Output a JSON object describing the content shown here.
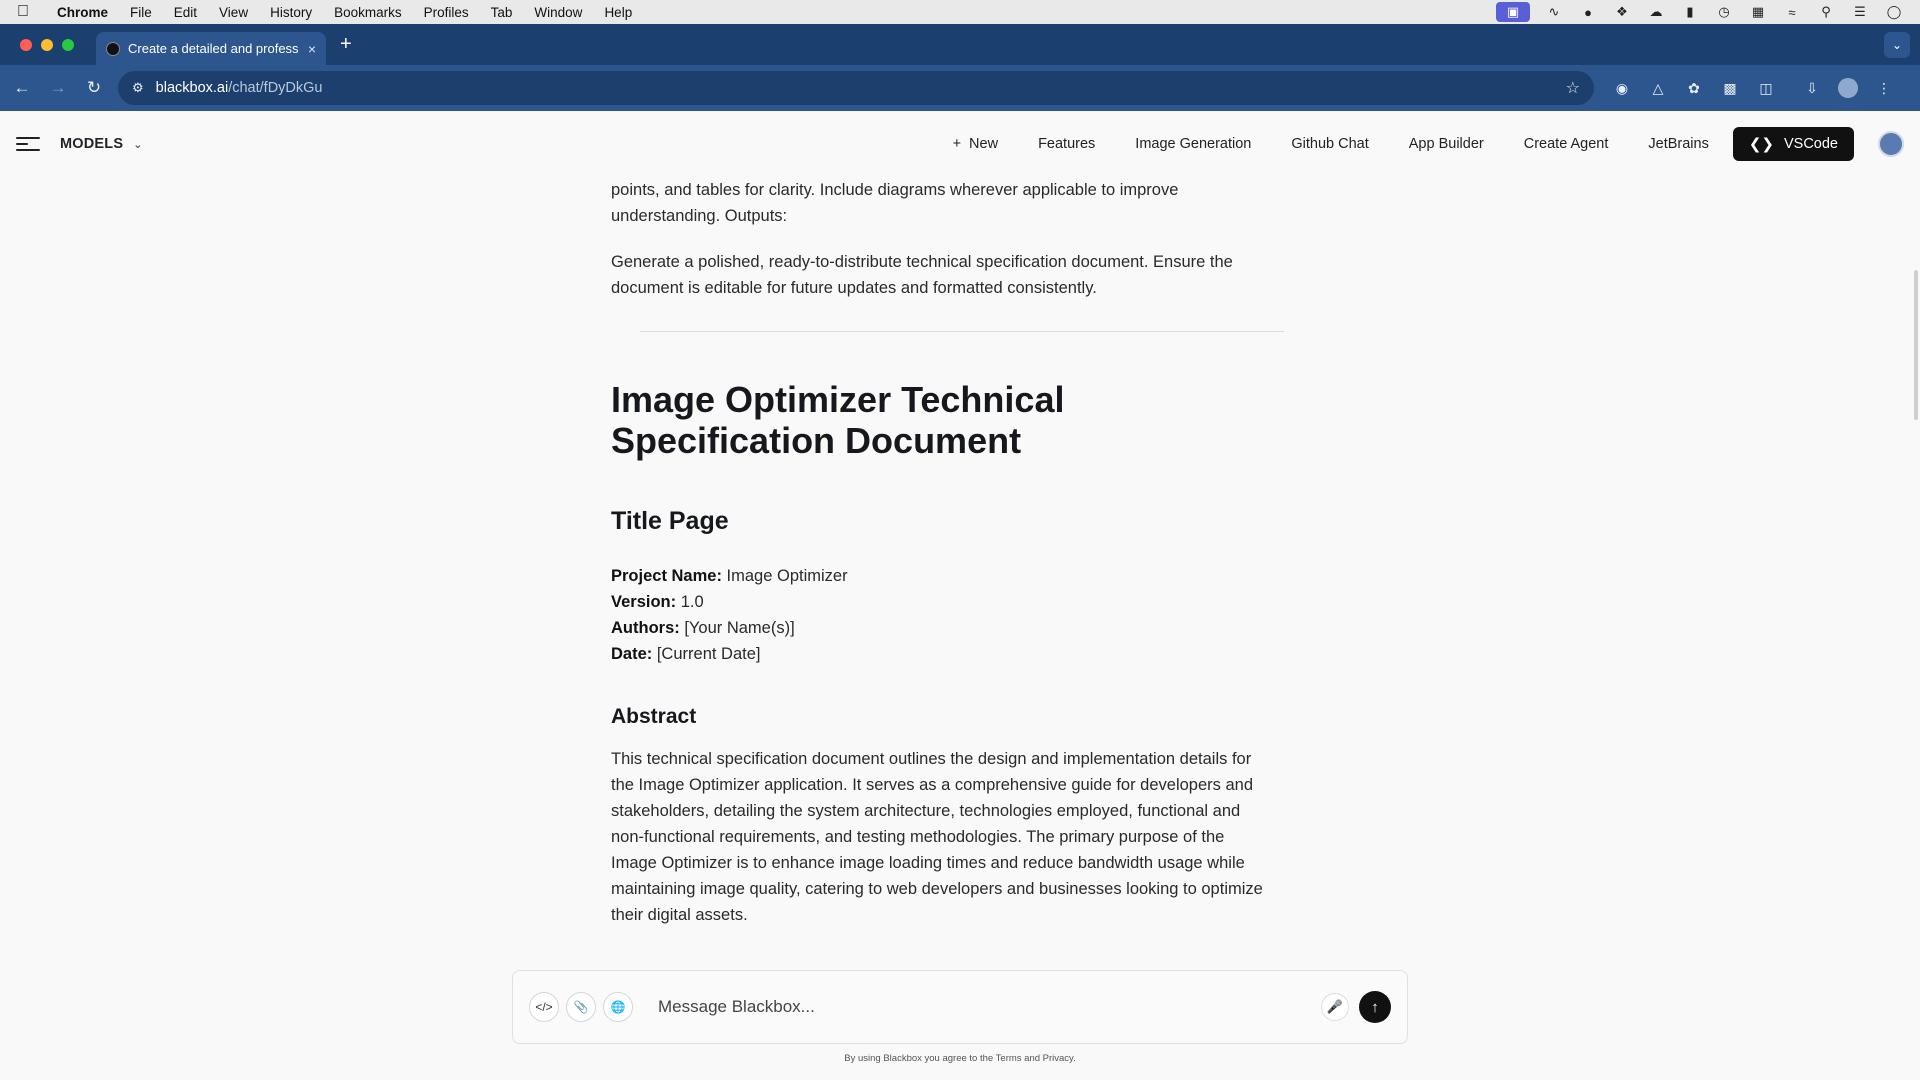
{
  "menubar": {
    "apple": "",
    "items": [
      "Chrome",
      "File",
      "Edit",
      "View",
      "History",
      "Bookmarks",
      "Profiles",
      "Tab",
      "Window",
      "Help"
    ]
  },
  "browser": {
    "tab_title": "Create a detailed and profess",
    "tab_close": "×",
    "new_tab": "+",
    "url_domain": "blackbox.ai",
    "url_path": "/chat/fDyDkGu"
  },
  "app": {
    "models_label": "MODELS",
    "nav": {
      "new": "New",
      "features": "Features",
      "image_generation": "Image Generation",
      "github_chat": "Github Chat",
      "app_builder": "App Builder",
      "create_agent": "Create Agent",
      "jetbrains": "JetBrains",
      "vscode": "VSCode"
    }
  },
  "content": {
    "p1": "points, and tables for clarity. Include diagrams wherever applicable to improve understanding. Outputs:",
    "p2": "Generate a polished, ready-to-distribute technical specification document. Ensure the document is editable for future updates and formatted consistently.",
    "doc_title": "Image Optimizer Technical Specification Document",
    "title_page_heading": "Title Page",
    "meta": {
      "project_name_label": "Project Name:",
      "project_name": " Image Optimizer",
      "version_label": "Version:",
      "version": " 1.0",
      "authors_label": "Authors:",
      "authors": " [Your Name(s)]",
      "date_label": "Date:",
      "date": " [Current Date]"
    },
    "abstract_heading": "Abstract",
    "abstract": "This technical specification document outlines the design and implementation details for the Image Optimizer application. It serves as a comprehensive guide for developers and stakeholders, detailing the system architecture, technologies employed, functional and non-functional requirements, and testing methodologies. The primary purpose of the Image Optimizer is to enhance image loading times and reduce bandwidth usage while maintaining image quality, catering to web developers and businesses looking to optimize their digital assets."
  },
  "composer": {
    "placeholder": "Message Blackbox...",
    "footnote": "By using Blackbox you agree to the Terms and Privacy."
  },
  "colors": {
    "tabstrip": "#1b3f6e",
    "toolbar": "#2c568d",
    "page_bg": "#f9f9f9",
    "vscode_btn": "#111111"
  }
}
